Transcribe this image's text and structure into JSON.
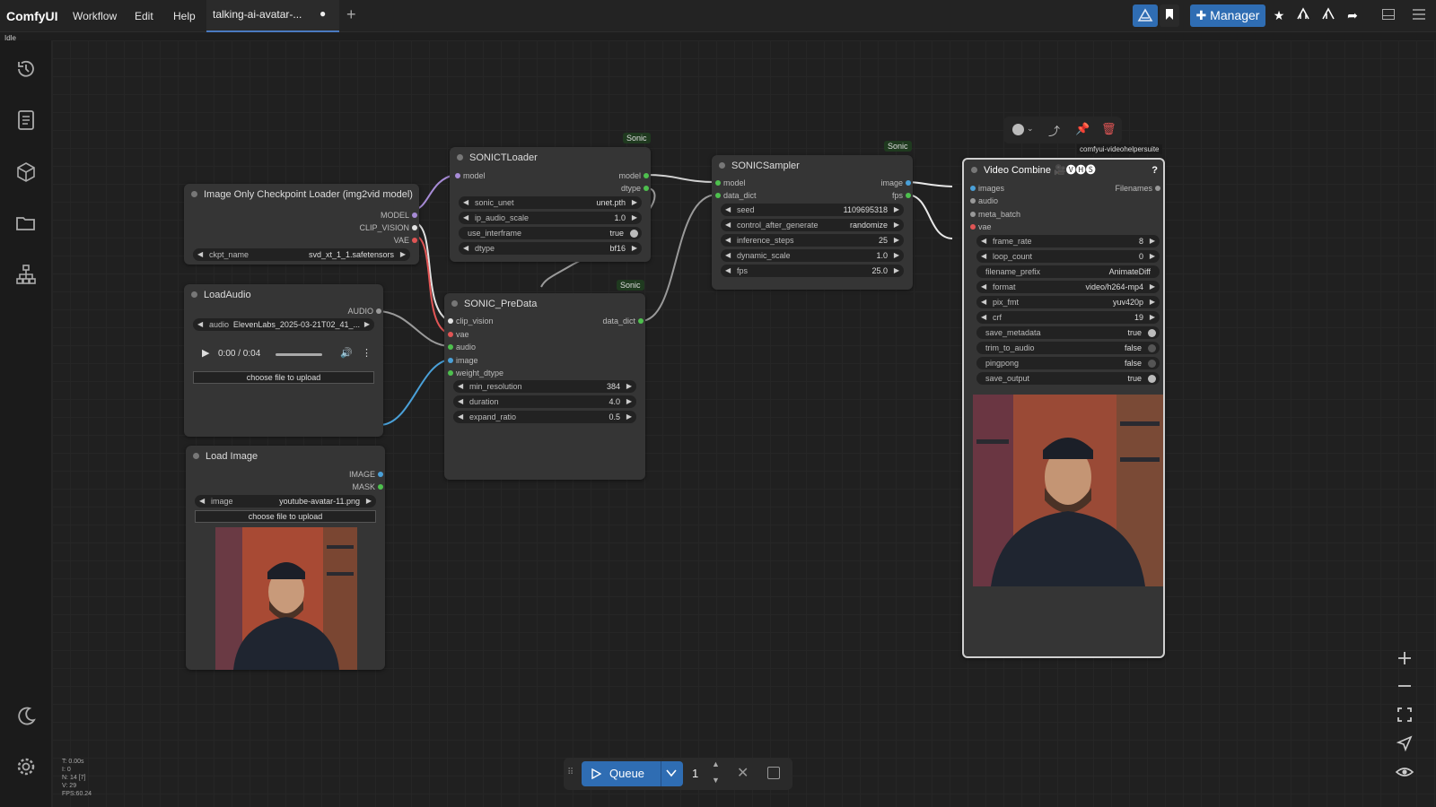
{
  "app": {
    "brand": "ComfyUI",
    "menu": [
      "Workflow",
      "Edit",
      "Help"
    ],
    "tab": "talking-ai-avatar-...",
    "tab_dot": "●",
    "status": "Idle"
  },
  "toolbar": {
    "manager": "Manager",
    "colors": {
      "accent": "#2f6db3"
    }
  },
  "nodes": {
    "checkpoint": {
      "title": "Image Only Checkpoint Loader (img2vid model)",
      "outputs": [
        "MODEL",
        "CLIP_VISION",
        "VAE"
      ],
      "ckpt_label": "ckpt_name",
      "ckpt_value": "svd_xt_1_1.safetensors"
    },
    "loadaudio": {
      "title": "LoadAudio",
      "output": "AUDIO",
      "audio_label": "audio",
      "audio_value": "ElevenLabs_2025-03-21T02_41_...",
      "time": "0:00 / 0:04",
      "upload": "choose file to upload"
    },
    "loadimage": {
      "title": "Load Image",
      "outputs": [
        "IMAGE",
        "MASK"
      ],
      "image_label": "image",
      "image_value": "youtube-avatar-11.png",
      "upload": "choose file to upload"
    },
    "sonicloader": {
      "title": "SONICTLoader",
      "badge": "Sonic",
      "input": "model",
      "outputs": [
        "model",
        "dtype"
      ],
      "widgets": [
        {
          "l": "sonic_unet",
          "v": "unet.pth"
        },
        {
          "l": "ip_audio_scale",
          "v": "1.0"
        },
        {
          "l": "use_interframe",
          "v": "true"
        },
        {
          "l": "dtype",
          "v": "bf16"
        }
      ]
    },
    "predata": {
      "title": "SONIC_PreData",
      "badge": "Sonic",
      "inputs": [
        "clip_vision",
        "vae",
        "audio",
        "image",
        "weight_dtype"
      ],
      "output": "data_dict",
      "widgets": [
        {
          "l": "min_resolution",
          "v": "384"
        },
        {
          "l": "duration",
          "v": "4.0"
        },
        {
          "l": "expand_ratio",
          "v": "0.5"
        }
      ]
    },
    "sampler": {
      "title": "SONICSampler",
      "badge": "Sonic",
      "inputs": [
        "model",
        "data_dict"
      ],
      "outputs": [
        "image",
        "fps"
      ],
      "widgets": [
        {
          "l": "seed",
          "v": "1109695318"
        },
        {
          "l": "control_after_generate",
          "v": "randomize"
        },
        {
          "l": "inference_steps",
          "v": "25"
        },
        {
          "l": "dynamic_scale",
          "v": "1.0"
        },
        {
          "l": "fps",
          "v": "25.0"
        }
      ]
    },
    "videocombine": {
      "title": "Video Combine 🎥🅥🅗🅢",
      "badge": "comfyui-videohelpersuite",
      "help": "?",
      "inputs": [
        "images",
        "audio",
        "meta_batch",
        "vae"
      ],
      "output": "Filenames",
      "widgets": [
        {
          "l": "frame_rate",
          "v": "8"
        },
        {
          "l": "loop_count",
          "v": "0"
        },
        {
          "l": "filename_prefix",
          "v": "AnimateDiff"
        },
        {
          "l": "format",
          "v": "video/h264-mp4"
        },
        {
          "l": "pix_fmt",
          "v": "yuv420p"
        },
        {
          "l": "crf",
          "v": "19"
        },
        {
          "l": "save_metadata",
          "v": "true"
        },
        {
          "l": "trim_to_audio",
          "v": "false"
        },
        {
          "l": "pingpong",
          "v": "false"
        },
        {
          "l": "save_output",
          "v": "true"
        }
      ]
    }
  },
  "stats": {
    "t": "T: 0.00s",
    "i": "I: 0",
    "n": "N: 14 [7]",
    "v": "V: 29",
    "fps": "FPS:60.24"
  },
  "queue": {
    "label": "Queue",
    "count": "1"
  }
}
